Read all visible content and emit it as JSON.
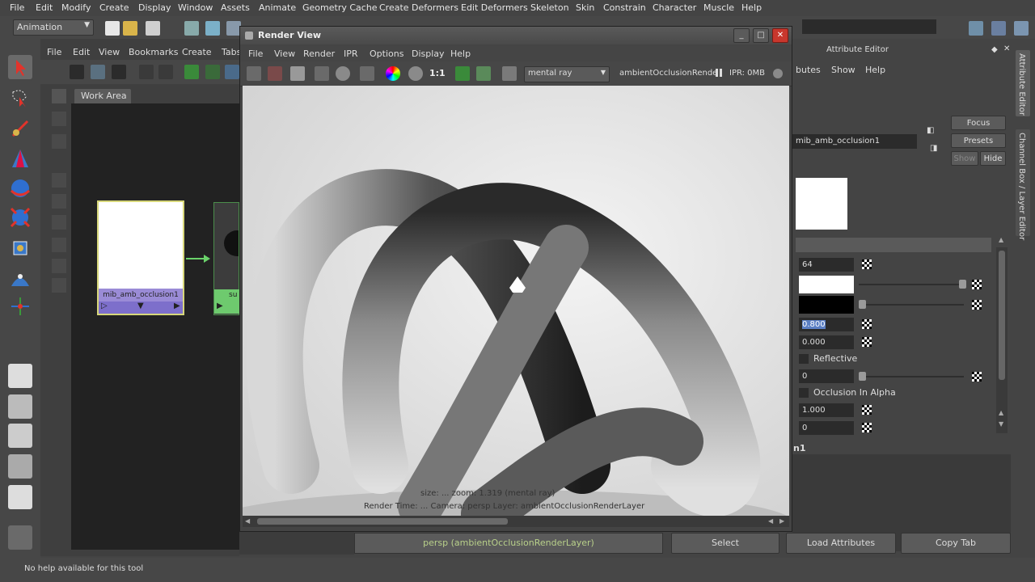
{
  "main_menu": [
    "File",
    "Edit",
    "Modify",
    "Create",
    "Display",
    "Window",
    "Assets",
    "Animate",
    "Geometry Cache",
    "Create Deformers",
    "Edit Deformers",
    "Skeleton",
    "Skin",
    "Constrain",
    "Character",
    "Muscle",
    "Help"
  ],
  "status_line": {
    "mode": "Animation"
  },
  "hypershade": {
    "menu": [
      "File",
      "Edit",
      "View",
      "Bookmarks",
      "Create",
      "Tabs"
    ],
    "tab": "Work Area",
    "node_label": "mib_amb_occlusion1",
    "node2_label": "su"
  },
  "render_view": {
    "title": "Render View",
    "menu": [
      "File",
      "View",
      "Render",
      "IPR",
      "Options",
      "Display",
      "Help"
    ],
    "renderer": "mental ray",
    "layer": "ambientOcclusionRende",
    "ipr": "IPR: 0MB",
    "info_line1": "size:  ...  zoom: 1.319    (mental ray)",
    "info_line2": "Render Time: ...   Camera: persp     Layer: ambientOcclusionRenderLayer"
  },
  "attribute_editor": {
    "title": "Attribute Editor",
    "menu": [
      "butes",
      "Show",
      "Help"
    ],
    "node_name": "mib_amb_occlusion1",
    "focus": "Focus",
    "presets": "Presets",
    "show": "Show",
    "hide": "Hide",
    "fields": {
      "samples": "64",
      "spread": "0.800",
      "max_distance": "0.000",
      "falloff": "0",
      "id_nonself": "1.000",
      "id_inclexcl": "0"
    },
    "reflective": "Reflective",
    "occlusion_in_alpha": "Occlusion In Alpha",
    "bottom_label": "n1",
    "slider_levels": {
      "bright": 1.0,
      "dark": 0.0,
      "falloff": 0.0
    }
  },
  "vertical_tabs": [
    "Attribute Editor",
    "Channel Box / Layer Editor"
  ],
  "camera_bar": "persp (ambientOcclusionRenderLayer)",
  "bottom_buttons": {
    "select": "Select",
    "load_attributes": "Load Attributes",
    "copy_tab": "Copy Tab"
  },
  "help_line": "No help available for this tool",
  "colors": {
    "accent_node": "#9a8bd6",
    "node_border": "#d7d77a",
    "close_button": "#c8372d",
    "camera_text": "#b8d08a"
  }
}
